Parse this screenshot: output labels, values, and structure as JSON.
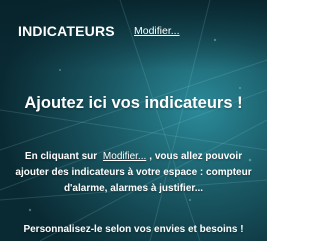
{
  "header": {
    "title": "INDICATEURS",
    "modify_link": "Modifier..."
  },
  "main": {
    "headline": "Ajoutez ici vos indicateurs !",
    "description_before": "En cliquant sur",
    "description_link": "Modifier...",
    "description_after": ", vous allez pouvoir ajouter des indicateurs à votre espace : compteur d'alarme, alarmes à justifier...",
    "footer": "Personnalisez-le selon vos envies et besoins !"
  },
  "colors": {
    "background_dark": "#0a2a33",
    "background_teal": "#1f6f7d",
    "text": "#ffffff"
  }
}
